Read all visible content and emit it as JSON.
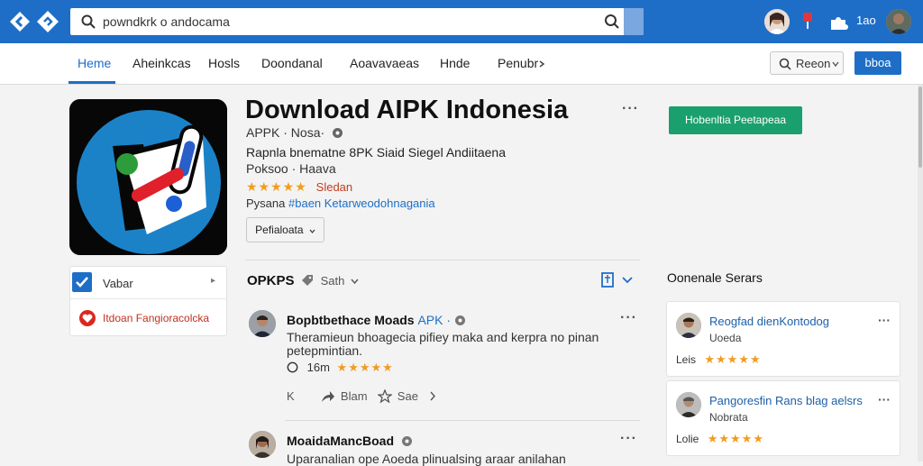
{
  "colors": {
    "brand": "#1e6ec7",
    "install": "#1aa06e",
    "star": "#f19c1f",
    "alert": "#c43c1f"
  },
  "topbar": {
    "search_value": "powndkrk o andocama",
    "user_label": "1ao"
  },
  "nav": {
    "items": [
      "Heme",
      "Aheinkcas",
      "Hosls",
      "Doondanal",
      "Aoavavaeas",
      "Hnde",
      "Penubr"
    ],
    "active_index": 0,
    "region_label": "Reeon",
    "action_label": "bboa"
  },
  "app": {
    "title": "Download AIPK Indonesia",
    "subtitle": "APPK · Nosa·",
    "line1": "Rapnla bnematne 8PK Siaid Siegel Andiitaena",
    "line2": "Poksoo · Haava",
    "stars": "★★★★★",
    "rating_value": 4.5,
    "rating_label": "Sledan",
    "tags_prefix": "Pysana",
    "tags_link": "#baen Ketarweodohnagania",
    "perm_button": "Pefialoata",
    "install_button": "Hobenltia Peetapeaa"
  },
  "side": {
    "item1": "Vabar",
    "item2": "Itdoan Fangioracolcka"
  },
  "reviews_section": {
    "title": "OPKPS",
    "sort_label": "Sath",
    "reviews": [
      {
        "name": "Bopbtbethace Moads",
        "name_tag": "APK ·",
        "body": "Theramieun bhoagecia pifiey maka and kerpra no pinan petepmintian.",
        "meta_count": "16m",
        "stars": "★★★★★",
        "rating": 5,
        "action1": "K",
        "action2": "Blam",
        "action3": "Sae"
      },
      {
        "name": "MoaidaMancBoad",
        "body": "Uparanalian ope Aoeda plinualsing araar anilahan",
        "rating": 0
      }
    ]
  },
  "right_panel": {
    "title": "Oonenale Serars",
    "cards": [
      {
        "name": "Reogfad dienKontodog",
        "sub": "Uoeda",
        "rate_label": "Leis",
        "stars": "★★★★★",
        "rating": 5
      },
      {
        "name": "Pangoresfin Rans blag aelsrs",
        "sub": "Nobrata",
        "rate_label": "Lolie",
        "stars": "★★★★★",
        "rating": 4.5
      }
    ]
  }
}
